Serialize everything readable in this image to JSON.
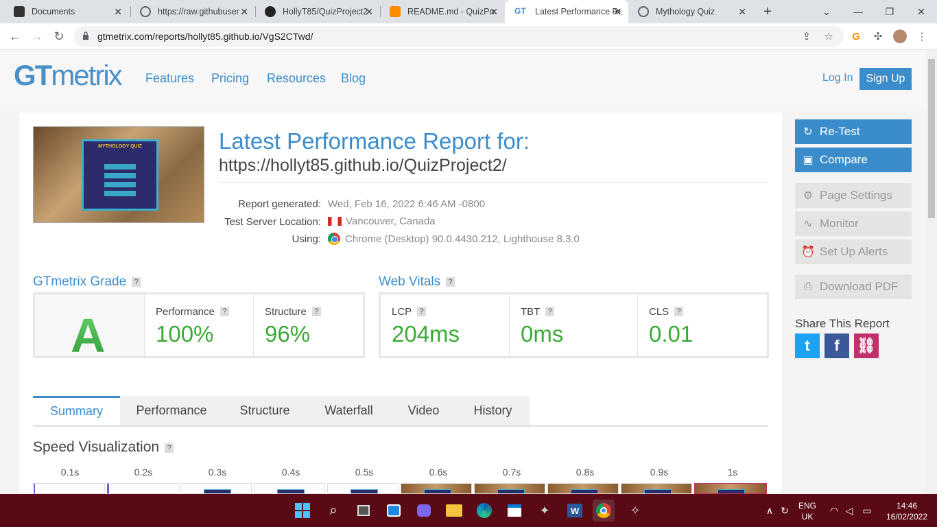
{
  "browser": {
    "tabs": [
      {
        "label": "Documents",
        "icon": "documents-icon"
      },
      {
        "label": "https://raw.githubuser",
        "icon": "globe-icon"
      },
      {
        "label": "HollyT85/QuizProject2",
        "icon": "github-icon"
      },
      {
        "label": "README.md - QuizPro",
        "icon": "gitpod-icon"
      },
      {
        "label": "Latest Performance Re",
        "icon": "gtmetrix-icon"
      },
      {
        "label": "Mythology Quiz",
        "icon": "globe-icon"
      }
    ],
    "new_tab": "+",
    "url": "gtmetrix.com/reports/hollyt85.github.io/VgS2CTwd/"
  },
  "site": {
    "logo_gt": "GT",
    "logo_metrix": "metrix",
    "nav": [
      "Features",
      "Pricing",
      "Resources",
      "Blog"
    ],
    "login": "Log In",
    "signup": "Sign Up"
  },
  "report": {
    "thumb_title": "MYTHOLOGY QUIZ",
    "title": "Latest Performance Report for:",
    "url": "https://hollyt85.github.io/QuizProject2/",
    "meta": [
      {
        "key": "Report generated:",
        "value": "Wed, Feb 16, 2022 6:46 AM -0800"
      },
      {
        "key": "Test Server Location:",
        "value": "Vancouver, Canada"
      },
      {
        "key": "Using:",
        "value": "Chrome (Desktop) 90.0.4430.212, Lighthouse 8.3.0"
      }
    ]
  },
  "grade": {
    "heading": "GTmetrix Grade",
    "letter": "A",
    "performance_label": "Performance",
    "performance": "100%",
    "structure_label": "Structure",
    "structure": "96%"
  },
  "vitals": {
    "heading": "Web Vitals",
    "lcp_label": "LCP",
    "lcp": "204ms",
    "tbt_label": "TBT",
    "tbt": "0ms",
    "cls_label": "CLS",
    "cls": "0.01"
  },
  "help_mark": "?",
  "page_tabs": [
    "Summary",
    "Performance",
    "Structure",
    "Waterfall",
    "Video",
    "History"
  ],
  "speed": {
    "heading": "Speed Visualization",
    "ticks": [
      "0.1s",
      "0.2s",
      "0.3s",
      "0.4s",
      "0.5s",
      "0.6s",
      "0.7s",
      "0.8s",
      "0.9s",
      "1s"
    ]
  },
  "sidebar": {
    "retest": "Re-Test",
    "compare": "Compare",
    "page_settings": "Page Settings",
    "monitor": "Monitor",
    "alerts": "Set Up Alerts",
    "pdf": "Download PDF",
    "share_heading": "Share This Report"
  },
  "taskbar": {
    "lang": "ENG",
    "region": "UK",
    "time": "14:46",
    "date": "16/02/2022"
  },
  "colors": {
    "brand_blue": "#3a8ccb",
    "grade_green": "#3aaa35",
    "twitter": "#1da1f2",
    "facebook": "#3b5998",
    "link": "#c0306a"
  }
}
